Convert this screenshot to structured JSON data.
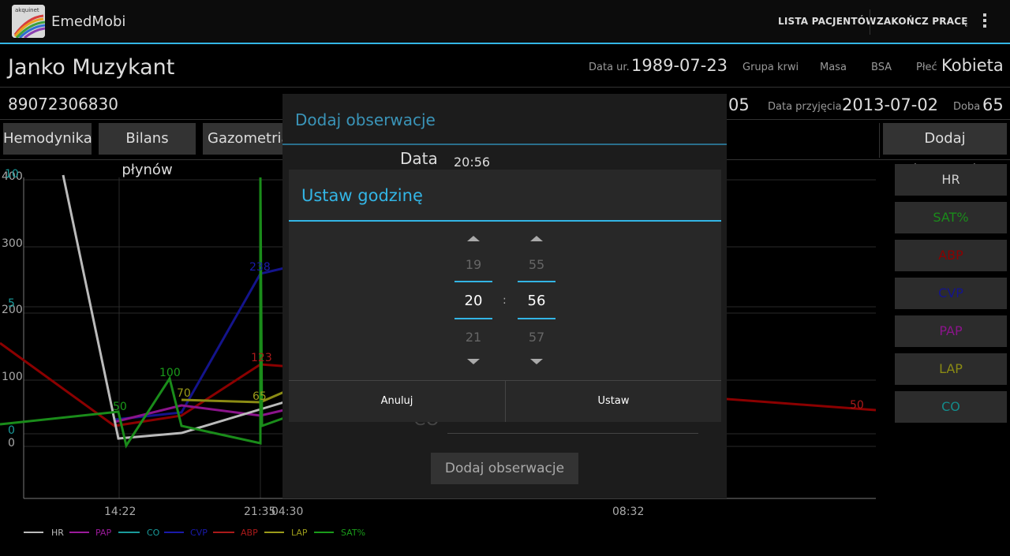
{
  "app": {
    "title": "EmedMobi",
    "logo_text": "akquinet"
  },
  "actionbar": {
    "patients_label": "LISTA PACJENTÓW",
    "finish_label": "ZAKOŃCZ PRACĘ"
  },
  "patient": {
    "name": "Janko Muzykant",
    "id": "89072306830",
    "dob_label": "Data ur.",
    "dob": "1989-07-23",
    "blood_label": "Grupa krwi",
    "mass_label": "Masa",
    "bsa_label": "BSA",
    "sex_label": "Płeć",
    "sex": "Kobieta",
    "partial_value": "05",
    "admission_label": "Data przyjęcia",
    "admission": "2013-07-02",
    "day_label": "Doba",
    "day": "65"
  },
  "tabs": [
    "Hemodynika",
    "Bilans płynów",
    "Gazometria"
  ],
  "add_observation_button": "Dodaj obserwacje",
  "series_buttons": [
    {
      "label": "HR",
      "color": "#cfcfcf"
    },
    {
      "label": "SAT%",
      "color": "#1a8c1a"
    },
    {
      "label": "ABP",
      "color": "#8b0000"
    },
    {
      "label": "CVP",
      "color": "#14148c"
    },
    {
      "label": "PAP",
      "color": "#8b148b"
    },
    {
      "label": "LAP",
      "color": "#8b8b14"
    },
    {
      "label": "CO",
      "color": "#148b8b"
    }
  ],
  "chart_data": {
    "type": "line",
    "y_ticks": [
      "400",
      "300",
      "200",
      "100",
      "0"
    ],
    "y2_ticks": [
      "10",
      "5",
      "0"
    ],
    "x_ticks": [
      "14:22",
      "21:35",
      "04:30",
      "08:32"
    ],
    "ylim": [
      0,
      400
    ],
    "point_labels": {
      "sat_50": "50",
      "sat_100": "100",
      "lap_70": "70",
      "lap_65": "65",
      "cvp_238": "238",
      "abp_123": "123",
      "abp_50": "50"
    },
    "legend": [
      {
        "name": "HR",
        "color": "#cfcfcf"
      },
      {
        "name": "PAP",
        "color": "#9b1a9b"
      },
      {
        "name": "CO",
        "color": "#1a9b9b"
      },
      {
        "name": "CVP",
        "color": "#1a1aab"
      },
      {
        "name": "ABP",
        "color": "#ab1a1a"
      },
      {
        "name": "LAP",
        "color": "#9b9b1a"
      },
      {
        "name": "SAT%",
        "color": "#1a9b1a"
      }
    ]
  },
  "outer_dialog": {
    "title": "Dodaj obserwacje",
    "date_label": "Data",
    "date_value": "20:56",
    "field_hint": "CO",
    "submit": "Dodaj obserwacje"
  },
  "time_dialog": {
    "title": "Ustaw godzinę",
    "hour_prev": "19",
    "hour": "20",
    "hour_next": "21",
    "separator": ":",
    "min_prev": "55",
    "min": "56",
    "min_next": "57",
    "cancel": "Anuluj",
    "set": "Ustaw"
  }
}
